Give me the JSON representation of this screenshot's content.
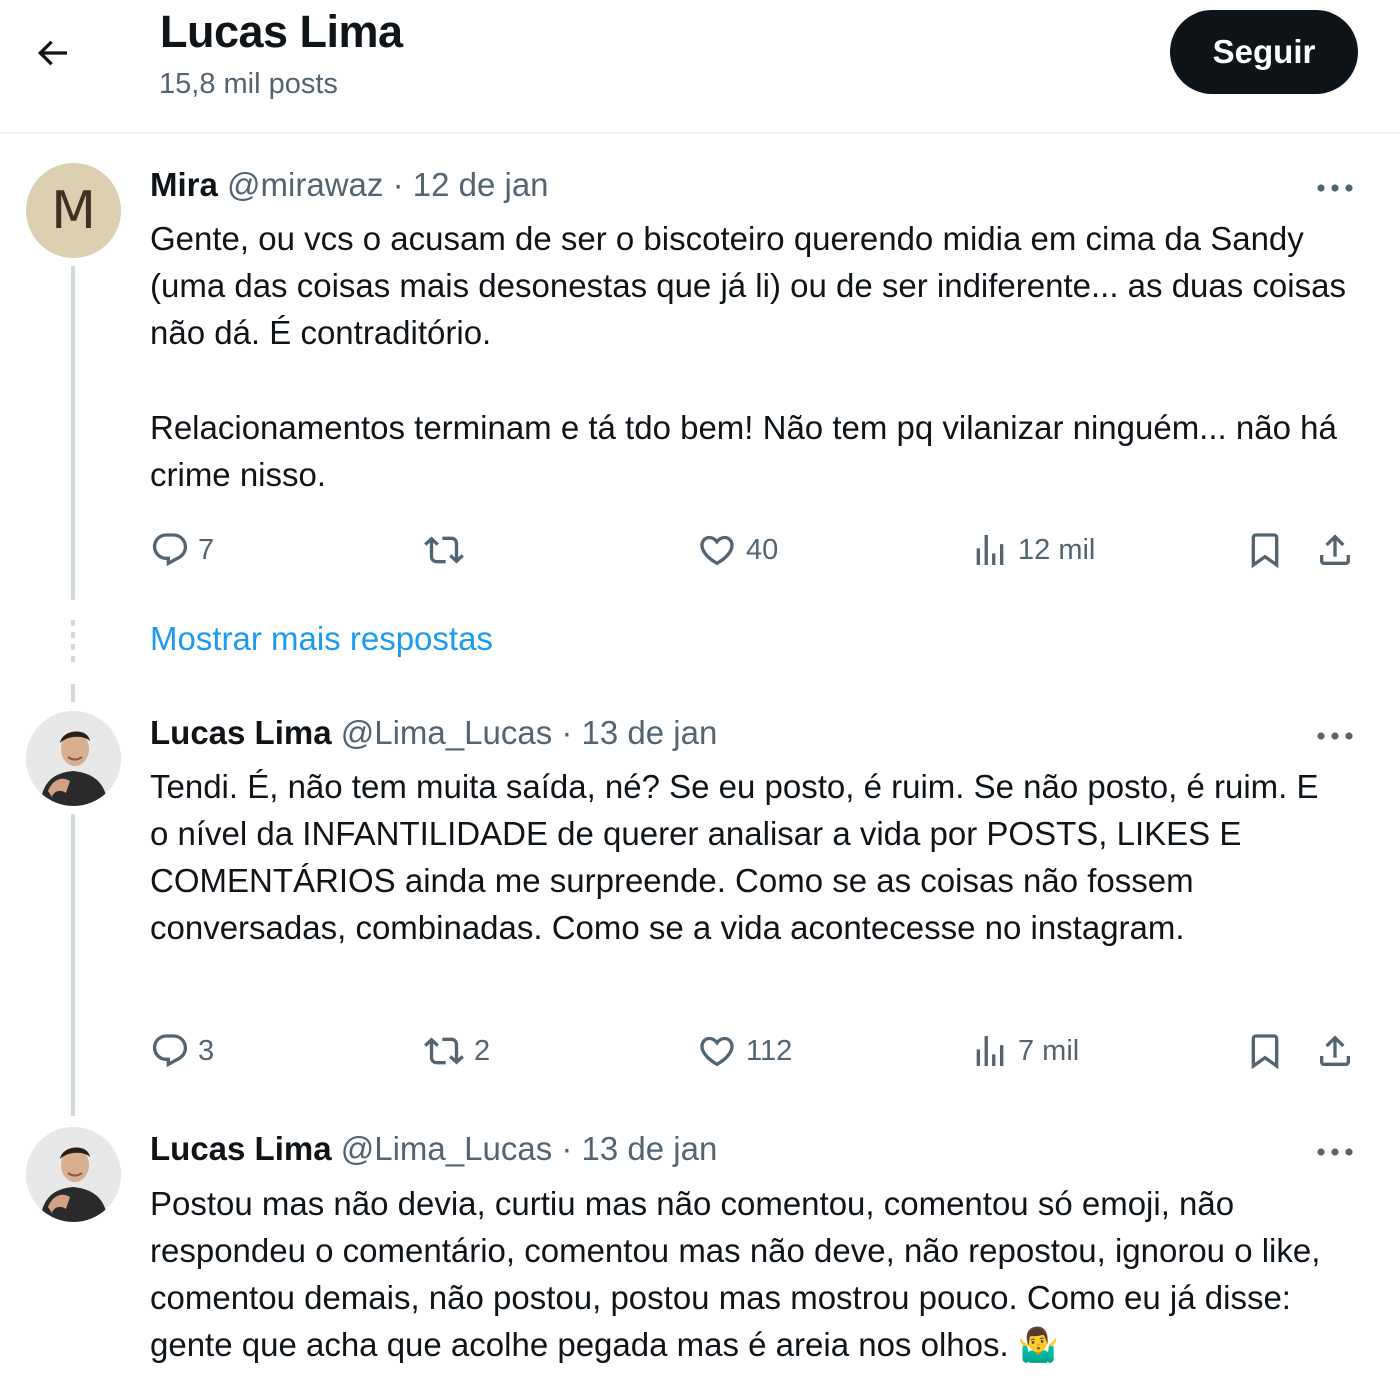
{
  "header": {
    "title": "Lucas Lima",
    "subtitle": "15,8 mil posts",
    "follow_label": "Seguir"
  },
  "show_more_label": "Mostrar mais respostas",
  "posts": [
    {
      "avatar_letter": "M",
      "name": "Mira",
      "handle": "@mirawaz",
      "separator": "·",
      "date": "12 de jan",
      "paragraphs": [
        "Gente, ou vcs o acusam de ser o biscoteiro querendo midia em cima da Sandy (uma das coisas mais desonestas que já li) ou de ser indiferente... as duas coisas não dá. É contraditório.",
        "Relacionamentos terminam e tá tdo bem! Não tem pq vilanizar ninguém... não há crime nisso."
      ],
      "replies": "7",
      "reposts": "",
      "likes": "40",
      "views": "12 mil"
    },
    {
      "name": "Lucas Lima",
      "handle": "@Lima_Lucas",
      "separator": "·",
      "date": "13 de jan",
      "paragraphs": [
        "Tendi. É, não tem muita saída, né? Se eu posto, é ruim. Se não posto, é ruim. E o nível da INFANTILIDADE de querer analisar a vida por POSTS, LIKES E COMENTÁRIOS ainda me surpreende. Como se as coisas não fossem conversadas, combinadas. Como se a vida acontecesse no instagram."
      ],
      "replies": "3",
      "reposts": "2",
      "likes": "112",
      "views": "7 mil"
    },
    {
      "name": "Lucas Lima",
      "handle": "@Lima_Lucas",
      "separator": "·",
      "date": "13 de jan",
      "paragraphs": [
        "Postou mas não devia, curtiu mas não comentou, comentou só emoji, não respondeu o comentário, comentou mas não deve, não repostou, ignorou o like, comentou demais, não postou, postou mas mostrou pouco. Como eu já disse: gente que acha que acolhe pegada mas é areia nos olhos. 🤷‍♂️"
      ]
    }
  ],
  "colors": {
    "text": "#0f1419",
    "secondary": "#536471",
    "link": "#1d9bf0",
    "follow_bg": "#0f1419",
    "thread_line": "#cfd9de"
  }
}
